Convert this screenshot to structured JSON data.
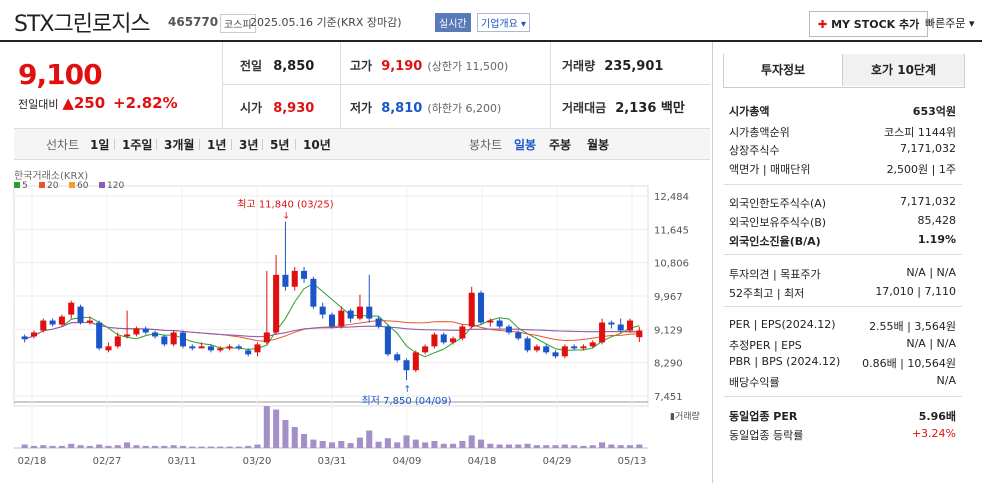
{
  "header": {
    "title": "STX그린로지스",
    "code": "465770",
    "market_tag": "코스피",
    "date_text": "2025.05.16 기준(KRX 장마감)",
    "realtime_tag": "실시간",
    "company_info": "기업개요",
    "mystock_label": "MY STOCK 추가",
    "quick_order": "빠른주문"
  },
  "price": {
    "current": "9,100",
    "change_label": "전일대비",
    "change_value": "250",
    "change_pct": "+2.82%"
  },
  "quote": {
    "prev_label": "전일",
    "prev_value": "8,850",
    "high_label": "고가",
    "high_value": "9,190",
    "high_limit": "(상한가 11,500)",
    "volume_label": "거래량",
    "volume_value": "235,901",
    "open_label": "시가",
    "open_value": "8,930",
    "low_label": "저가",
    "low_value": "8,810",
    "low_limit": "(하한가 6,200)",
    "amount_label": "거래대금",
    "amount_value": "2,136 백만"
  },
  "period": {
    "line_label": "선차트",
    "line_items": [
      "1일",
      "1주일",
      "3개월",
      "1년",
      "3년",
      "5년",
      "10년"
    ],
    "candle_label": "봉차트",
    "candle_items": [
      "일봉",
      "주봉",
      "월봉"
    ]
  },
  "right_tabs": {
    "info": "투자정보",
    "hoga": "호가 10단계"
  },
  "info": {
    "market_cap": {
      "label": "시가총액",
      "value": "653억원"
    },
    "cap_rank": {
      "label": "시가총액순위",
      "value": "코스피 1144위"
    },
    "shares": {
      "label": "상장주식수",
      "value": "7,171,032"
    },
    "face": {
      "label": "액면가 | 매매단위",
      "value": "2,500원 | 1주"
    },
    "foreign_limit": {
      "label": "외국인한도주식수(A)",
      "value": "7,171,032"
    },
    "foreign_hold": {
      "label": "외국인보유주식수(B)",
      "value": "85,428"
    },
    "foreign_rate": {
      "label": "외국인소진율(B/A)",
      "value": "1.19%"
    },
    "opinion": {
      "label": "투자의견 | 목표주가",
      "value": "N/A | N/A"
    },
    "week52": {
      "label": "52주최고 | 최저",
      "value": "17,010 | 7,110"
    },
    "per": {
      "label": "PER | EPS(2024.12)",
      "value": "2.55배 | 3,564원"
    },
    "est_per": {
      "label": "추정PER | EPS",
      "value": "N/A | N/A"
    },
    "pbr": {
      "label": "PBR | BPS (2024.12)",
      "value": "0.86배 | 10,564원"
    },
    "dividend": {
      "label": "배당수익률",
      "value": "N/A"
    },
    "sector_per": {
      "label": "동일업종 PER",
      "value": "5.96배"
    },
    "sector_rate": {
      "label": "동일업종 등락률",
      "value": "+3.24%"
    }
  },
  "chart_data": {
    "type": "candlestick",
    "source_label": "한국거래소(KRX)",
    "legend": [
      {
        "name": "5",
        "color": "#2ca02c"
      },
      {
        "name": "20",
        "color": "#e8542f"
      },
      {
        "name": "60",
        "color": "#f0a030"
      },
      {
        "name": "120",
        "color": "#8a5cc0"
      }
    ],
    "y_ticks": [
      "12,484",
      "11,645",
      "10,806",
      "9,967",
      "9,129",
      "8,290",
      "7,451"
    ],
    "ylim": [
      7451,
      12484
    ],
    "x_ticks": [
      "02/18",
      "02/27",
      "03/11",
      "03/20",
      "03/31",
      "04/09",
      "04/18",
      "04/29",
      "05/13"
    ],
    "max_annot": "최고 11,840 (03/25)",
    "min_annot": "최저 7,850 (04/09)",
    "volume_label": "거래량",
    "up_color": "#e01010",
    "down_color": "#1a56c8",
    "candles": [
      [
        8950,
        8880,
        9000,
        8800
      ],
      [
        8950,
        9050,
        9100,
        8900
      ],
      [
        9100,
        9350,
        9400,
        9050
      ],
      [
        9350,
        9250,
        9400,
        9200
      ],
      [
        9250,
        9450,
        9500,
        9200
      ],
      [
        9500,
        9800,
        9850,
        9400
      ],
      [
        9700,
        9300,
        9750,
        9250
      ],
      [
        9300,
        9350,
        9450,
        9250
      ],
      [
        9300,
        8650,
        9350,
        8600
      ],
      [
        8600,
        8700,
        8800,
        8550
      ],
      [
        8700,
        8950,
        9050,
        8650
      ],
      [
        8950,
        9000,
        9600,
        8900
      ],
      [
        9000,
        9150,
        9200,
        8950
      ],
      [
        9150,
        9050,
        9200,
        9000
      ],
      [
        9050,
        8950,
        9100,
        8900
      ],
      [
        8950,
        8750,
        9000,
        8700
      ],
      [
        8750,
        9050,
        9100,
        8700
      ],
      [
        9050,
        8700,
        9100,
        8650
      ],
      [
        8700,
        8650,
        8750,
        8600
      ],
      [
        8650,
        8700,
        8800,
        8650
      ],
      [
        8700,
        8600,
        8750,
        8550
      ],
      [
        8600,
        8650,
        8700,
        8550
      ],
      [
        8650,
        8700,
        8750,
        8600
      ],
      [
        8700,
        8650,
        8750,
        8600
      ],
      [
        8600,
        8500,
        8650,
        8450
      ],
      [
        8550,
        8750,
        8800,
        8450
      ],
      [
        8800,
        9050,
        10600,
        8750
      ],
      [
        9050,
        10500,
        11000,
        9000
      ],
      [
        10500,
        10200,
        11840,
        10100
      ],
      [
        10200,
        10600,
        10700,
        10100
      ],
      [
        10600,
        10400,
        10700,
        10300
      ],
      [
        10400,
        9700,
        10450,
        9650
      ],
      [
        9700,
        9500,
        9800,
        9400
      ],
      [
        9500,
        9200,
        9550,
        9150
      ],
      [
        9200,
        9600,
        9700,
        9150
      ],
      [
        9600,
        9400,
        9650,
        9300
      ],
      [
        9400,
        9700,
        10000,
        9350
      ],
      [
        9700,
        9400,
        10500,
        9300
      ],
      [
        9400,
        9200,
        9450,
        9150
      ],
      [
        9200,
        8500,
        9250,
        8450
      ],
      [
        8500,
        8350,
        8550,
        8300
      ],
      [
        8350,
        8100,
        8400,
        7850
      ],
      [
        8100,
        8550,
        8600,
        8050
      ],
      [
        8550,
        8700,
        8750,
        8500
      ],
      [
        8700,
        9000,
        9050,
        8650
      ],
      [
        9000,
        8800,
        9050,
        8750
      ],
      [
        8800,
        8900,
        8950,
        8750
      ],
      [
        8900,
        9200,
        9250,
        8850
      ],
      [
        9200,
        10050,
        10200,
        9150
      ],
      [
        10050,
        9300,
        10100,
        9250
      ],
      [
        9300,
        9350,
        9400,
        9200
      ],
      [
        9350,
        9200,
        9400,
        9150
      ],
      [
        9200,
        9050,
        9250,
        9000
      ],
      [
        9050,
        8900,
        9100,
        8850
      ],
      [
        8900,
        8600,
        8950,
        8550
      ],
      [
        8600,
        8700,
        8750,
        8550
      ],
      [
        8700,
        8550,
        8750,
        8500
      ],
      [
        8550,
        8450,
        8600,
        8400
      ],
      [
        8450,
        8700,
        8750,
        8400
      ],
      [
        8700,
        8650,
        8750,
        8600
      ],
      [
        8650,
        8700,
        8750,
        8600
      ],
      [
        8700,
        8800,
        8850,
        8650
      ],
      [
        8800,
        9300,
        9400,
        8750
      ],
      [
        9300,
        9250,
        9350,
        9150
      ],
      [
        9250,
        9100,
        9400,
        9050
      ],
      [
        9100,
        9350,
        9400,
        9050
      ],
      [
        8930,
        9100,
        9190,
        8810
      ]
    ],
    "volumes": [
      5,
      3,
      4,
      3,
      3,
      6,
      4,
      3,
      5,
      3,
      4,
      8,
      4,
      3,
      3,
      3,
      4,
      3,
      2,
      2,
      2,
      2,
      2,
      2,
      3,
      5,
      60,
      55,
      40,
      30,
      20,
      12,
      10,
      8,
      10,
      7,
      15,
      25,
      9,
      14,
      8,
      18,
      12,
      8,
      10,
      6,
      6,
      10,
      18,
      12,
      6,
      5,
      5,
      5,
      6,
      4,
      4,
      4,
      5,
      4,
      3,
      4,
      8,
      5,
      4,
      4,
      5
    ]
  }
}
